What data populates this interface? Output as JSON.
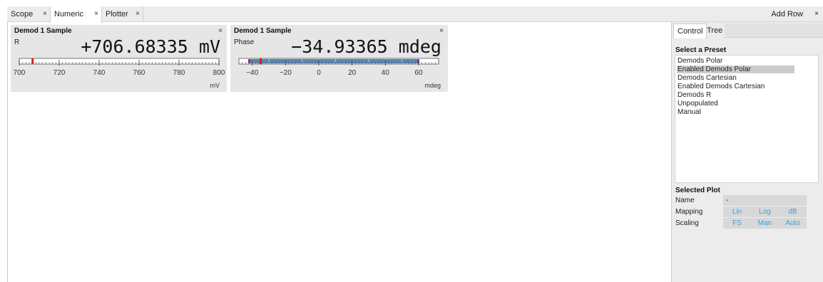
{
  "tabs": [
    {
      "label": "Scope",
      "close": "×"
    },
    {
      "label": "Numeric",
      "close": "×"
    },
    {
      "label": "Plotter",
      "close": "×"
    }
  ],
  "add_row": {
    "label": "Add Row",
    "close": "×"
  },
  "panels": [
    {
      "title": "Demod 1 Sample",
      "close": "×",
      "signal": "R",
      "value": "+706.68335",
      "unit": "mV",
      "scale_unit": "mV",
      "ticks": [
        "700",
        "720",
        "740",
        "760",
        "780",
        "800"
      ],
      "range": [
        700,
        800
      ],
      "marker_value": 706.68,
      "bar_fill": null
    },
    {
      "title": "Demod 1 Sample",
      "close": "×",
      "signal": "Phase",
      "value": "−34.93365",
      "unit": "mdeg",
      "scale_unit": "mdeg",
      "ticks": [
        "−40",
        "−20",
        "0",
        "20",
        "40",
        "60"
      ],
      "range": [
        -48,
        72
      ],
      "marker_value": -34.93,
      "bar_fill": [
        -40,
        60
      ]
    }
  ],
  "side": {
    "tabs": [
      "Control",
      "Tree"
    ],
    "preset_title": "Select a Preset",
    "presets": [
      "Demods Polar",
      "Enabled Demods Polar",
      "Demods Cartesian",
      "Enabled Demods Cartesian",
      "Demods R",
      "Unpopulated",
      "Manual"
    ],
    "selected_preset": "Enabled Demods Polar",
    "plot_title": "Selected Plot",
    "name_label": "Name",
    "name_value": "-",
    "mapping_label": "Mapping",
    "mapping_options": [
      "Lin",
      "Log",
      "dB"
    ],
    "scaling_label": "Scaling",
    "scaling_options": [
      "FS",
      "Man",
      "Auto"
    ]
  },
  "colors": {
    "marker": "#d42020",
    "bar_fill": "#5b84b1",
    "bar_edge": "#8a3a6a",
    "link": "#3b9fd8"
  }
}
